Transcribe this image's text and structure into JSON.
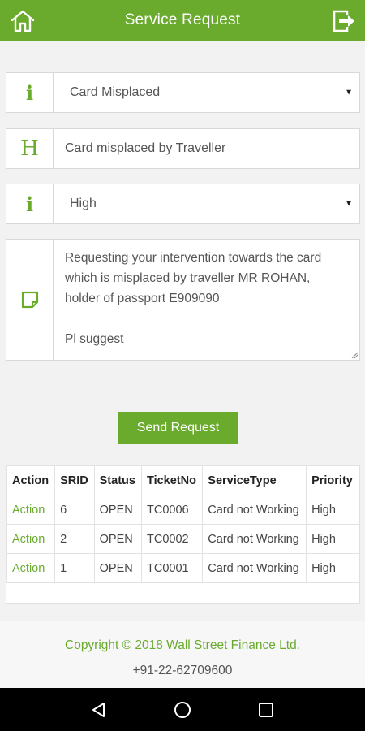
{
  "header": {
    "title": "Service Request"
  },
  "form": {
    "category": {
      "value": "Card Misplaced",
      "icon": "info-icon"
    },
    "subject": {
      "value": "Card misplaced by Traveller",
      "icon": "heading-icon"
    },
    "priority": {
      "value": "High",
      "icon": "info-icon"
    },
    "message": {
      "lines": [
        "Requesting your intervention towards the card",
        "which is misplaced by traveller MR ROHAN,",
        "holder of passport E909090",
        "Pl suggest"
      ],
      "icon": "note-icon"
    },
    "send_label": "Send Request"
  },
  "table": {
    "headers": [
      "Action",
      "SRID",
      "Status",
      "TicketNo",
      "ServiceType",
      "Priority"
    ],
    "rows": [
      [
        "Action",
        "6",
        "OPEN",
        "TC0006",
        "Card not Working",
        "High"
      ],
      [
        "Action",
        "2",
        "OPEN",
        "TC0002",
        "Card not Working",
        "High"
      ],
      [
        "Action",
        "1",
        "OPEN",
        "TC0001",
        "Card not Working",
        "High"
      ]
    ]
  },
  "footer": {
    "copyright": "Copyright © 2018 Wall Street Finance Ltd.",
    "phone": "+91-22-62709600"
  },
  "colors": {
    "accent": "#6aab2e",
    "navbar": "#000000"
  }
}
